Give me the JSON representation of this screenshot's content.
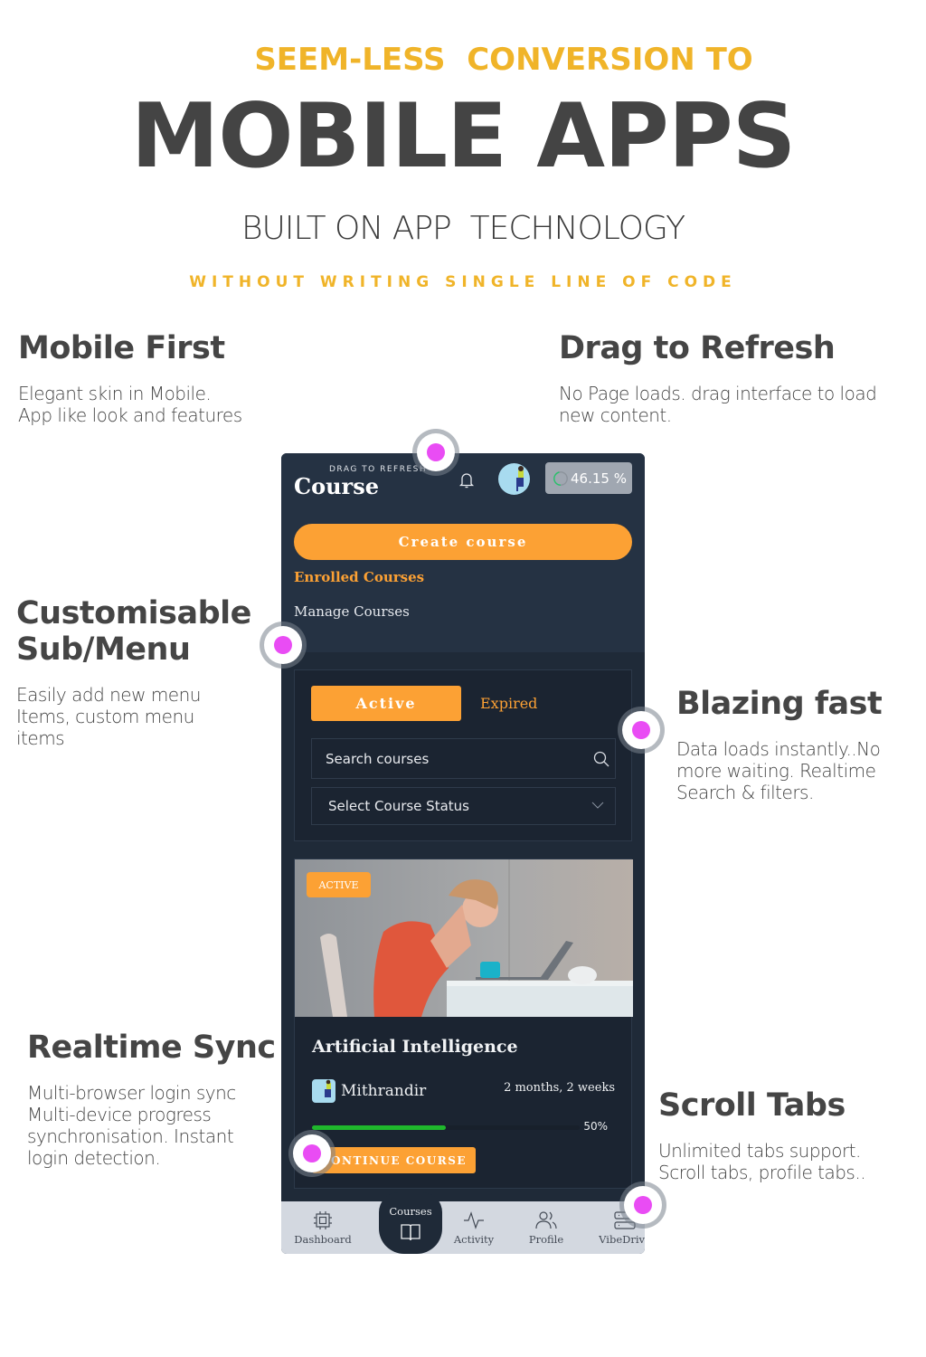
{
  "hero": {
    "kicker": "SEEM-LESS  CONVERSION TO",
    "title": "MOBILE APPS",
    "subtitle": "BUILT ON APP  TECHNOLOGY",
    "tagline": "WITHOUT WRITING SINGLE LINE OF CODE"
  },
  "features": [
    {
      "title": "Mobile First",
      "text": "Elegant skin in Mobile.\nApp like look and features"
    },
    {
      "title": "Drag to Refresh",
      "text": "No Page loads. drag interface to load new content."
    },
    {
      "title": "Customisable Sub/Menu",
      "text": "Easily add new menu Items, custom menu items"
    },
    {
      "title": "Blazing fast",
      "text": "Data loads instantly..No more waiting. Realtime Search & filters."
    },
    {
      "title": "Realtime Sync",
      "text": "Multi-browser login sync Multi-device progress synchronisation. Instant login detection."
    },
    {
      "title": "Scroll Tabs",
      "text": "Unlimited tabs support. Scroll tabs, profile tabs.."
    }
  ],
  "app": {
    "drag_hint": "DRAG TO REFRESH",
    "page_title": "Course",
    "progress_value": "46.15 %",
    "progress_fraction": 0.4615,
    "create_button": "Create course",
    "menu": [
      {
        "label": "Enrolled Courses",
        "active": true
      },
      {
        "label": "Manage Courses",
        "active": false
      }
    ],
    "tabs": [
      {
        "label": "Active",
        "active": true
      },
      {
        "label": "Expired",
        "active": false
      }
    ],
    "search_placeholder": "Search courses",
    "status_select": "Select Course Status",
    "course": {
      "badge": "ACTIVE",
      "title": "Artificial Intelligence",
      "author": "Mithrandir",
      "duration": "2 months, 2 weeks",
      "progress_percent": 50,
      "progress_label": "50%",
      "button": "CONTINUE COURSE"
    },
    "bottom_nav": [
      {
        "label": "Dashboard",
        "icon": "cpu-icon"
      },
      {
        "label": "Courses",
        "icon": "book-icon",
        "active": true
      },
      {
        "label": "Activity",
        "icon": "activity-icon"
      },
      {
        "label": "Profile",
        "icon": "users-icon"
      },
      {
        "label": "VibeDrive",
        "icon": "server-icon"
      }
    ]
  },
  "colors": {
    "accent": "#fca134",
    "kicker": "#f0b429",
    "phone_bg": "#253243",
    "marker": "#e94cf4",
    "progress": "#1fb82c"
  }
}
